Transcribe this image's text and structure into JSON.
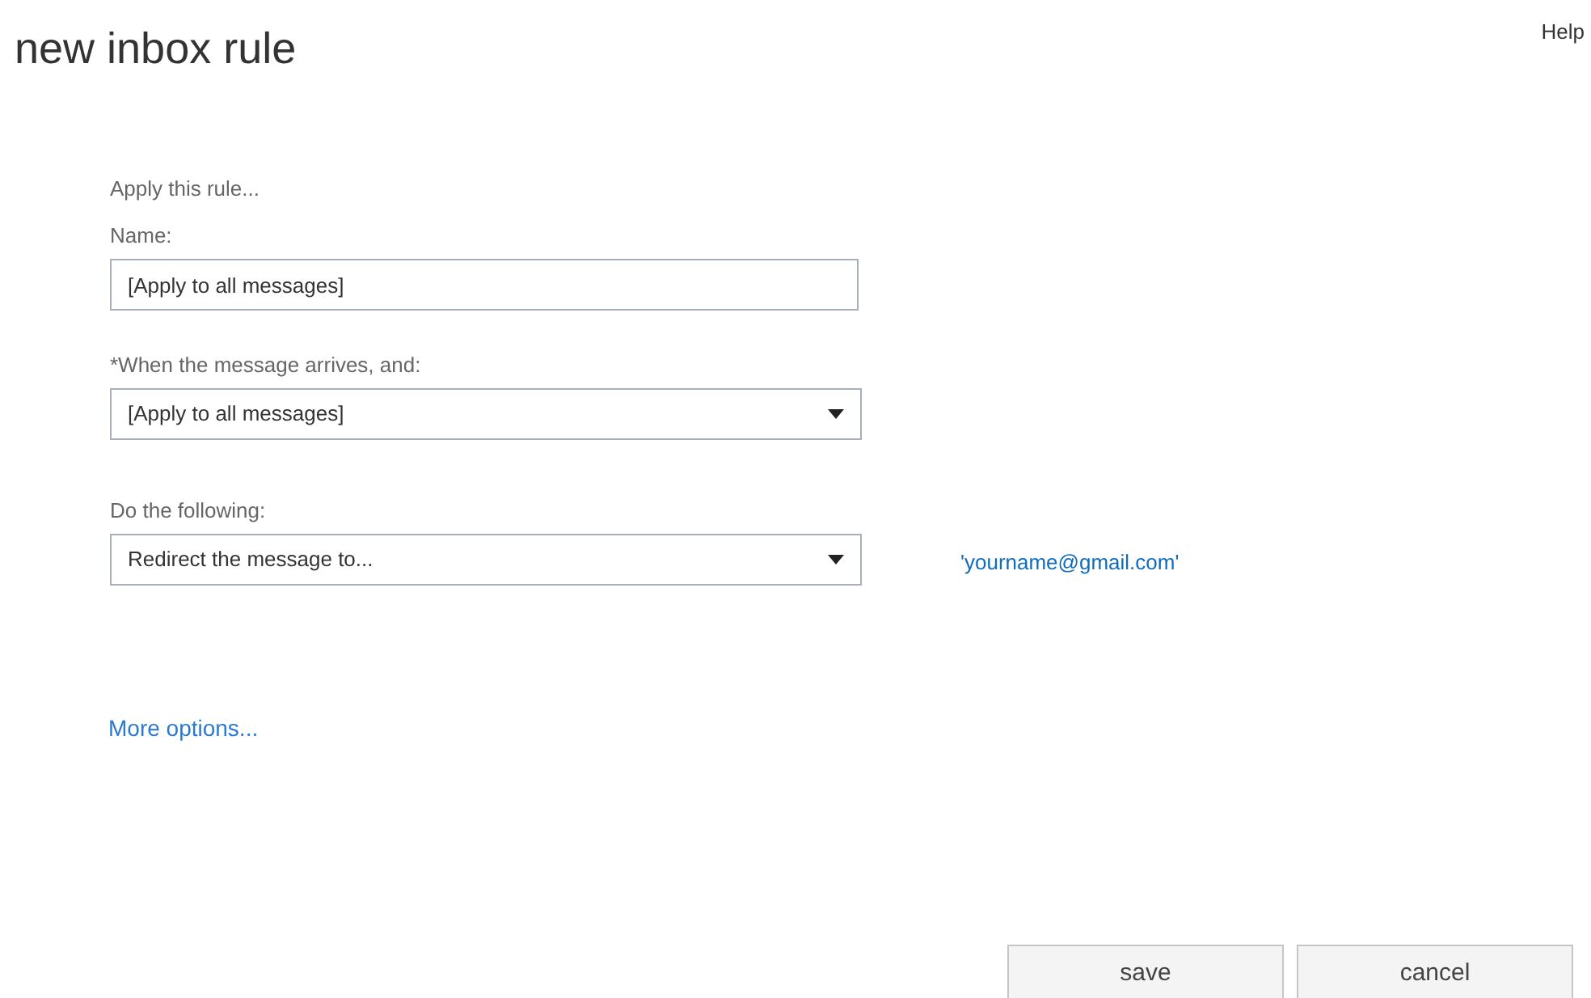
{
  "title": "new inbox rule",
  "help": "Help",
  "form": {
    "heading": "Apply this rule...",
    "fields": [
      {
        "kind": "text",
        "label": "Name:",
        "value": "[Apply to all messages]"
      },
      {
        "kind": "select",
        "label": "*When the message arrives, and:",
        "value": "[Apply to all messages]"
      },
      {
        "kind": "select",
        "label": "Do the following:",
        "value": "Redirect the message to...",
        "link": "'yourname@gmail.com'"
      }
    ],
    "more": "More options..."
  },
  "buttons": [
    "save",
    "cancel"
  ]
}
